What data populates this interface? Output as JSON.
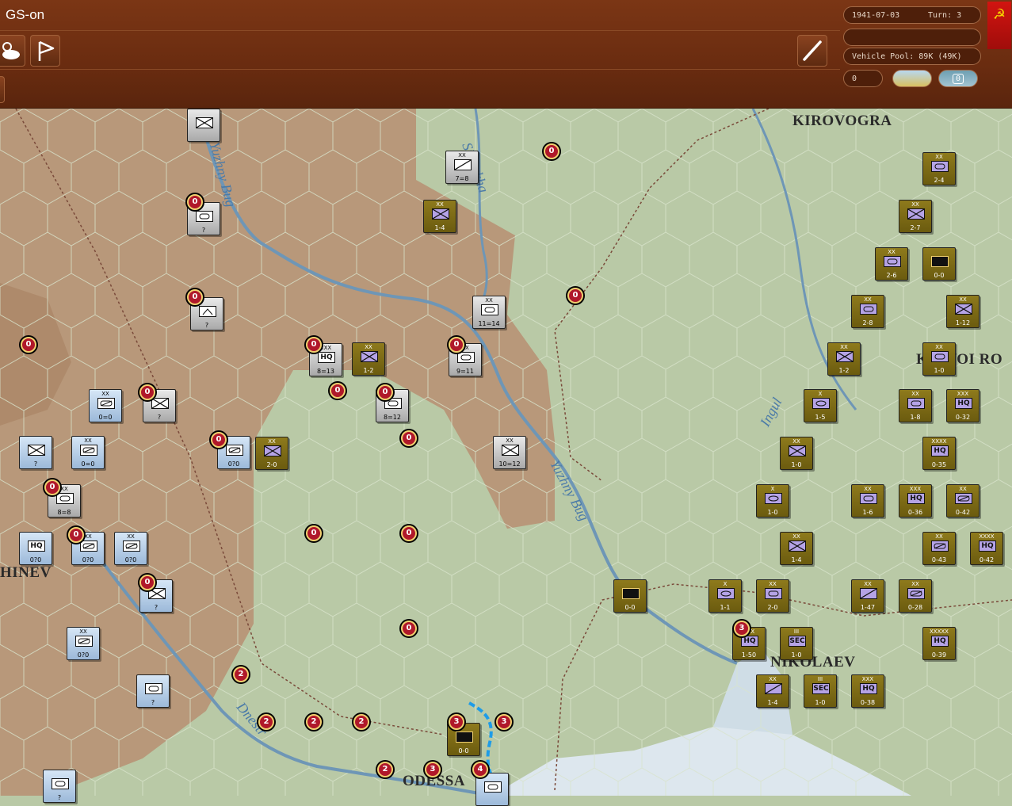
{
  "header": {
    "title": "GS-on"
  },
  "status": {
    "date": "1941-07-03",
    "turn": "Turn: 3",
    "blank": "",
    "vehicle_pool": "Vehicle Pool: 89K (49K)",
    "count": "0",
    "snow_value": "0"
  },
  "map": {
    "cities": [
      "KIROVOGRA",
      "KRIVOI RO",
      "NIKOLAEV",
      "ODESSA",
      "HINEV"
    ],
    "rivers": [
      "Sinyukha",
      "Yuzhny Bug",
      "Yuzhny Bug",
      "Ingul",
      "Dnestr"
    ],
    "axis_units": [
      {
        "size": "",
        "str": "",
        "kind": "inf"
      },
      {
        "size": "",
        "str": "?",
        "kind": "armor"
      },
      {
        "size": "XX",
        "str": "7=8",
        "kind": "slash"
      },
      {
        "size": "",
        "str": "?",
        "kind": "mtn"
      },
      {
        "size": "XX",
        "str": "11=14",
        "kind": "armor"
      },
      {
        "size": "XXX",
        "str": "8=13",
        "kind": "hq"
      },
      {
        "size": "XX",
        "str": "9=11",
        "kind": "armor"
      },
      {
        "size": "",
        "str": "8=12",
        "kind": "armor"
      },
      {
        "size": "",
        "str": "?",
        "kind": "inf"
      },
      {
        "size": "XX",
        "str": "0=0",
        "kind": "mech"
      },
      {
        "size": "",
        "str": "?",
        "kind": "inf"
      },
      {
        "size": "XX",
        "str": "0=0",
        "kind": "mech"
      },
      {
        "size": "",
        "str": "0?0",
        "kind": "mech"
      },
      {
        "size": "XX",
        "str": "10=12",
        "kind": "inf"
      },
      {
        "size": "XX",
        "str": "8=8",
        "kind": "armor"
      },
      {
        "size": "",
        "str": "0?0",
        "kind": "hq"
      },
      {
        "size": "XX",
        "str": "0?0",
        "kind": "mech"
      },
      {
        "size": "XX",
        "str": "0?0",
        "kind": "mech"
      },
      {
        "size": "",
        "str": "?",
        "kind": "inf"
      },
      {
        "size": "XX",
        "str": "0?0",
        "kind": "mech"
      },
      {
        "size": "",
        "str": "?",
        "kind": "armor"
      },
      {
        "size": "",
        "str": "?",
        "kind": "armor"
      },
      {
        "size": "",
        "str": "",
        "kind": "armor"
      }
    ],
    "soviet_units": [
      {
        "size": "XX",
        "str": "1-4",
        "kind": "inf"
      },
      {
        "size": "XX",
        "str": "1-2",
        "kind": "inf"
      },
      {
        "size": "XX",
        "str": "2-0",
        "kind": "inf"
      },
      {
        "size": "XX",
        "str": "2-4",
        "kind": "armor"
      },
      {
        "size": "XX",
        "str": "2-7",
        "kind": "inf"
      },
      {
        "size": "XX",
        "str": "2-6",
        "kind": "armor"
      },
      {
        "size": "",
        "str": "0-0",
        "kind": "fort"
      },
      {
        "size": "XX",
        "str": "2-8",
        "kind": "armor"
      },
      {
        "size": "XX",
        "str": "1-12",
        "kind": "inf"
      },
      {
        "size": "XX",
        "str": "1-2",
        "kind": "inf"
      },
      {
        "size": "XX",
        "str": "1-0",
        "kind": "armor"
      },
      {
        "size": "X",
        "str": "1-5",
        "kind": "cav"
      },
      {
        "size": "XX",
        "str": "1-8",
        "kind": "armor"
      },
      {
        "size": "XXX",
        "str": "0-32",
        "kind": "hq"
      },
      {
        "size": "XX",
        "str": "1-0",
        "kind": "inf"
      },
      {
        "size": "XXXX",
        "str": "0-35",
        "kind": "hq"
      },
      {
        "size": "X",
        "str": "1-0",
        "kind": "cav"
      },
      {
        "size": "XX",
        "str": "1-6",
        "kind": "armor"
      },
      {
        "size": "XXX",
        "str": "0-36",
        "kind": "hq"
      },
      {
        "size": "XX",
        "str": "0-42",
        "kind": "mech"
      },
      {
        "size": "XX",
        "str": "1-4",
        "kind": "inf"
      },
      {
        "size": "XX",
        "str": "0-43",
        "kind": "mech"
      },
      {
        "size": "XXXX",
        "str": "0-42",
        "kind": "hq"
      },
      {
        "size": "",
        "str": "0-0",
        "kind": "fort"
      },
      {
        "size": "X",
        "str": "1-1",
        "kind": "cav"
      },
      {
        "size": "XX",
        "str": "2-0",
        "kind": "armor"
      },
      {
        "size": "XX",
        "str": "1-47",
        "kind": "slash"
      },
      {
        "size": "XX",
        "str": "0-28",
        "kind": "mech"
      },
      {
        "size": "XXX",
        "str": "1-50",
        "kind": "hq"
      },
      {
        "size": "III",
        "str": "1-0",
        "kind": "sec"
      },
      {
        "size": "XXXXX",
        "str": "0-39",
        "kind": "hq"
      },
      {
        "size": "XX",
        "str": "1-4",
        "kind": "slash"
      },
      {
        "size": "III",
        "str": "1-0",
        "kind": "sec"
      },
      {
        "size": "XXX",
        "str": "0-38",
        "kind": "hq"
      },
      {
        "size": "",
        "str": "0-0",
        "kind": "fort"
      }
    ],
    "markers": [
      "0",
      "0",
      "0",
      "0",
      "0",
      "0",
      "0",
      "0",
      "0",
      "0",
      "0",
      "0",
      "0",
      "0",
      "0",
      "0",
      "0",
      "0",
      "2",
      "2",
      "2",
      "2",
      "3",
      "3",
      "3",
      "2",
      "3",
      "4"
    ]
  },
  "colors": {
    "axis_counter": "#c8c8c8",
    "axis_blue_counter": "#a9c4e2",
    "soviet_counter": "#7d6a15",
    "marker_red": "#b0182a",
    "header_brown": "#6a2c10",
    "steppe": "#b89a7a",
    "plain": "#b9c9a6",
    "sea": "#d8e4ec"
  },
  "icons": [
    "weather-icon",
    "flag-icon",
    "line-tool-icon",
    "hammer-sickle-icon"
  ]
}
